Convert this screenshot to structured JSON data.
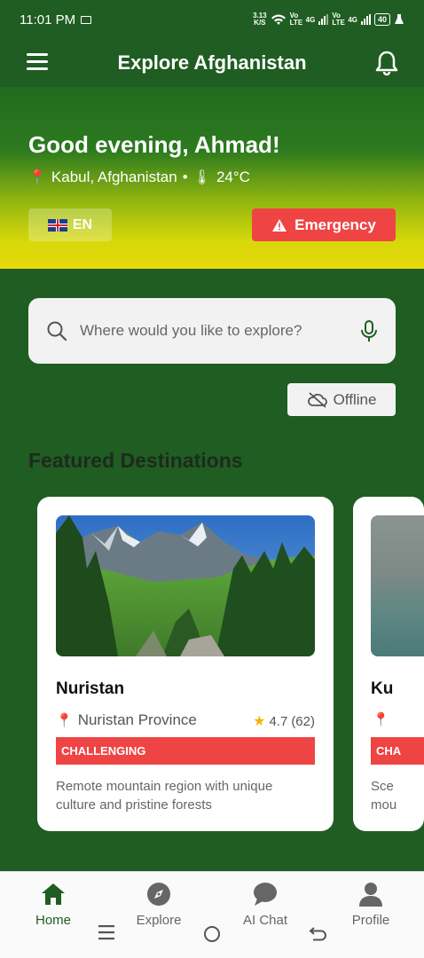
{
  "status_bar": {
    "time": "11:01 PM",
    "speed": "3.13",
    "speed_unit": "K/S",
    "net1": "Vo LTE",
    "net1_gen": "4G",
    "net2": "Vo LTE",
    "net2_gen": "4G",
    "battery": "40"
  },
  "header": {
    "title": "Explore Afghanistan",
    "menu_icon": "hamburger-menu-icon",
    "bell_icon": "bell-icon"
  },
  "hero": {
    "greeting": "Good evening, Ahmad!",
    "location": "Kabul, Afghanistan",
    "separator": "•",
    "temperature": "24°C",
    "language_button": "EN",
    "emergency_button": "Emergency"
  },
  "search": {
    "placeholder": "Where would you like to explore?",
    "offline_label": "Offline"
  },
  "featured": {
    "section_title": "Featured Destinations",
    "cards": [
      {
        "name": "Nuristan",
        "location": "Nuristan Province",
        "rating": "4.7",
        "reviews": "(62)",
        "difficulty": "CHALLENGING",
        "description": "Remote mountain region with unique culture and pristine forests"
      },
      {
        "name": "Ku",
        "location": "",
        "difficulty": "CHA",
        "description_line1": "Sce",
        "description_line2": "mou"
      }
    ]
  },
  "bottom_nav": {
    "items": [
      {
        "label": "Home",
        "icon": "home-icon"
      },
      {
        "label": "Explore",
        "icon": "compass-icon"
      },
      {
        "label": "AI Chat",
        "icon": "chat-bubble-icon"
      },
      {
        "label": "Profile",
        "icon": "person-icon"
      }
    ]
  },
  "colors": {
    "primary_green": "#1f5d22",
    "emergency_red": "#ef4444",
    "hero_yellow": "#e8d90b"
  }
}
